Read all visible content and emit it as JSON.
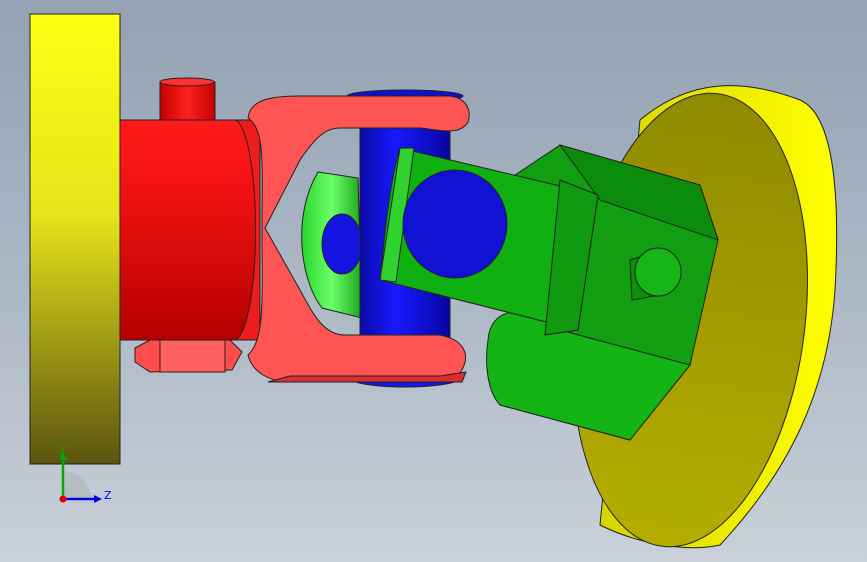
{
  "viewport": {
    "background_top": "#93a1b2",
    "background_bottom": "#c9d0d8"
  },
  "model": {
    "name": "universal-joint",
    "parts": [
      {
        "name": "left-flange-plate",
        "color": "#ffff00"
      },
      {
        "name": "red-hub-cylinder",
        "color": "#e00000"
      },
      {
        "name": "red-yoke",
        "color": "#ff5050"
      },
      {
        "name": "blue-cross-pin",
        "color": "#1010d8"
      },
      {
        "name": "green-yoke",
        "color": "#10c010"
      },
      {
        "name": "green-hub-cylinder",
        "color": "#10b010"
      },
      {
        "name": "right-flange-disc",
        "color": "#ffff00"
      }
    ]
  },
  "triad": {
    "y_label": "Y",
    "z_label": "Z",
    "y_color": "#00aa00",
    "z_color": "#0000ee",
    "x_color": "#dd0000"
  }
}
